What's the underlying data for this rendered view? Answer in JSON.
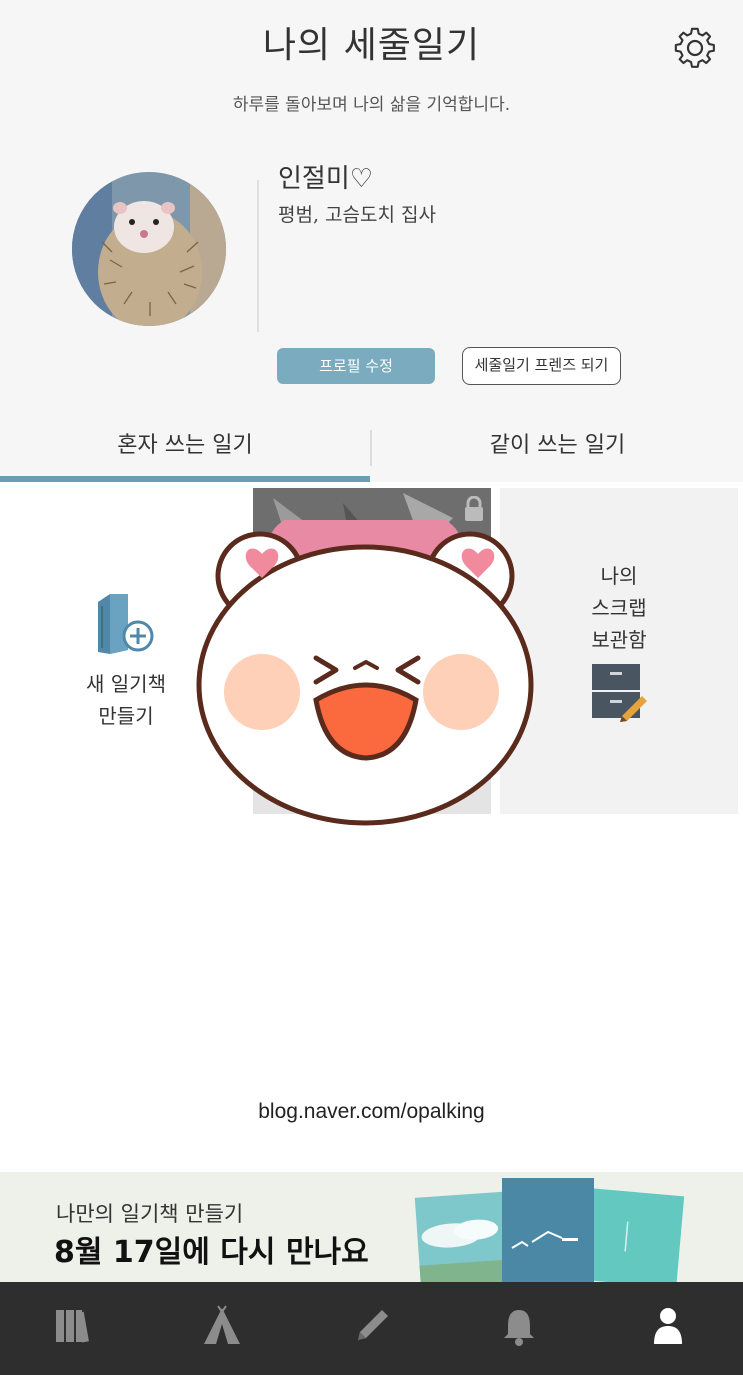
{
  "header": {
    "title": "나의 세줄일기",
    "subtitle": "하루를 돌아보며 나의 삶을 기억합니다."
  },
  "profile": {
    "name": "인절미♡",
    "description": "평범, 고슴도치 집사",
    "edit_label": "프로필 수정",
    "friends_label": "세줄일기 프렌즈 되기"
  },
  "tabs": [
    {
      "label": "혼자 쓰는 일기",
      "active": true
    },
    {
      "label": "같이 쓰는 일기",
      "active": false
    }
  ],
  "grid": {
    "new_book": {
      "line1": "새 일기책",
      "line2": "만들기"
    },
    "scrap": {
      "line1": "나의",
      "line2": "스크랩",
      "line3": "보관함"
    }
  },
  "watermark": "blog.naver.com/opalking",
  "banner": {
    "line1": "나만의 일기책 만들기",
    "line2": "8월 17일에 다시 만나요"
  },
  "nav": [
    {
      "icon": "library-icon",
      "active": false
    },
    {
      "icon": "tent-icon",
      "active": false
    },
    {
      "icon": "pencil-icon",
      "active": false
    },
    {
      "icon": "bell-icon",
      "active": false
    },
    {
      "icon": "person-icon",
      "active": true
    }
  ],
  "colors": {
    "accent": "#7aabbf",
    "tab_indicator": "#6b9db3",
    "nav_bg": "#2e2e2e"
  }
}
